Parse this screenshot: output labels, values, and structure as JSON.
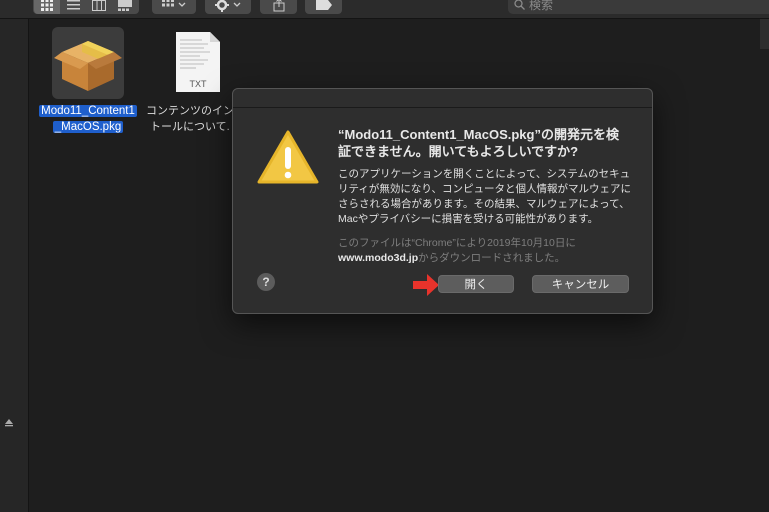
{
  "search": {
    "placeholder": "検索"
  },
  "files": [
    {
      "name_line1": "Modo11_Content1",
      "name_line2": "_MacOS.pkg",
      "icon": "package-icon"
    },
    {
      "name_line1": "コンテンツのイン",
      "name_line2": "トールについて.",
      "icon": "text-document-icon",
      "badge": "TXT"
    }
  ],
  "dialog": {
    "title_line1": "“Modo11_Content1_MacOS.pkg”の開発元を検",
    "title_line2": "証できません。開いてもよろしいですか?",
    "body_line1": "このアプリケーションを開くことによって、システムのセキュ",
    "body_line2": "リティが無効になり、コンピュータと個人情報がマルウェアに",
    "body_line3": "さらされる場合があります。その結果、マルウェアによって、",
    "body_line4": "Macやプライバシーに損害を受ける可能性があります。",
    "source_line1": "このファイルは“Chrome”により2019年10月10日に",
    "source_domain": "www.modo3d.jp",
    "source_line2_rest": "からダウンロードされました。",
    "help_label": "?",
    "open_label": "開く",
    "cancel_label": "キャンセル"
  },
  "colors": {
    "selection": "#1f5fcc",
    "warning": "#f2c744",
    "arrow": "#e8332b"
  }
}
